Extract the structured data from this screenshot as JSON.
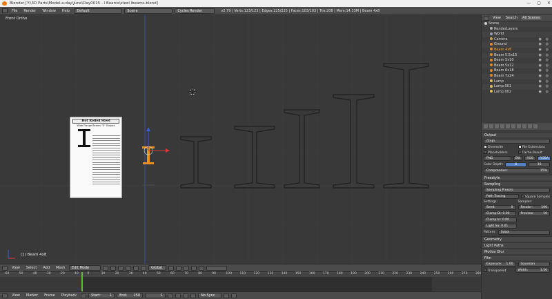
{
  "window": {
    "title": "Blender [Y:\\3D Parts\\Model-a-day\\June\\Day0015 - I Beams\\steel ibeams.blend]",
    "controls": [
      "—",
      "▢",
      "✕"
    ]
  },
  "menubar": {
    "items": [
      "File",
      "Render",
      "Window",
      "Help"
    ],
    "layout": "Default",
    "scene": "Scene",
    "engine": "Cycles Render",
    "stats": "v2.79 | Verts:123/123 | Edges:225/225 | Faces:103/103 | Tris:208 | Mem:14.33M | Beam 4x8"
  },
  "viewport": {
    "view_label": "Front Ortho",
    "object_label": "(1) Beam 4x8",
    "reference": {
      "title": "Hot Rolled Steel",
      "subtitle": "Wide Flange Beams \"S\" Shapes"
    }
  },
  "view_header": {
    "items": [
      "View",
      "Select",
      "Add",
      "Mesh"
    ],
    "mode": "Edit Mode",
    "orientation": "Global"
  },
  "timeline": {
    "ticks": [
      "-60",
      "-50",
      "-40",
      "-30",
      "-20",
      "-10",
      "0",
      "10",
      "20",
      "30",
      "40",
      "50",
      "60",
      "70",
      "80",
      "90",
      "100",
      "110",
      "120",
      "130",
      "140",
      "150",
      "160",
      "170",
      "180",
      "190",
      "200",
      "210",
      "220",
      "230",
      "240",
      "250",
      "260",
      "270",
      "280"
    ],
    "current_frame": "1",
    "menu": [
      "View",
      "Marker",
      "Frame",
      "Playback"
    ],
    "start_label": "Start:",
    "start": "1",
    "end_label": "End:",
    "end": "250",
    "frame": "1",
    "sync": "No Sync"
  },
  "outliner": {
    "tabs": [
      "View",
      "Search",
      "All Scenes"
    ],
    "items": [
      {
        "name": "Scene",
        "color": "#d0d0d0",
        "selected": false
      },
      {
        "name": "RenderLayers",
        "color": "#b0b0b0",
        "selected": false
      },
      {
        "name": "World",
        "color": "#9aa0b5",
        "selected": false
      },
      {
        "name": "Camera",
        "color": "#c8a25a",
        "selected": false
      },
      {
        "name": "Ground",
        "color": "#e08a2c",
        "selected": false
      },
      {
        "name": "Beam 4x8",
        "color": "#e08a2c",
        "selected": true
      },
      {
        "name": "Beam 5.5x15",
        "color": "#e08a2c",
        "selected": false
      },
      {
        "name": "Beam 5x10",
        "color": "#e08a2c",
        "selected": false
      },
      {
        "name": "Beam 5x12",
        "color": "#e08a2c",
        "selected": false
      },
      {
        "name": "Beam 6x18",
        "color": "#e08a2c",
        "selected": false
      },
      {
        "name": "Beam 7x24",
        "color": "#e08a2c",
        "selected": false
      },
      {
        "name": "Lamp",
        "color": "#e0c060",
        "selected": false
      },
      {
        "name": "Lamp.001",
        "color": "#e0c060",
        "selected": false
      },
      {
        "name": "Lamp.002",
        "color": "#e0c060",
        "selected": false
      }
    ]
  },
  "properties": {
    "output_header": "Output",
    "output_path": "/tmp\\",
    "overwrite": "Overwrite",
    "file_extensions": "File Extensions",
    "placeholders": "Placeholders",
    "cache_result": "Cache Result",
    "format": "PNG",
    "channels": [
      "BW",
      "RGB",
      "RGBA"
    ],
    "color_depth_label": "Color Depth:",
    "depths": [
      "8",
      "16"
    ],
    "compression_label": "Compression:",
    "compression": "15%",
    "freestyle": "Freestyle",
    "sampling_header": "Sampling",
    "sampling_presets": "Sampling Presets",
    "integrator": "Path Tracing",
    "square_samples": "Square Samples",
    "settings_label": "Settings:",
    "samples_label": "Samples:",
    "seed_label": "Seed:",
    "seed": "0",
    "render_label": "Render:",
    "render": "100",
    "clamp_direct": "Clamp Di: 0.00",
    "preview_label": "Preview:",
    "preview": "10",
    "clamp_indirect": "Clamp In: 0.00",
    "light_sampling": "Light Sa: 0.01",
    "pattern_label": "Pattern:",
    "pattern": "Sobol",
    "geometry": "Geometry",
    "light_paths": "Light Paths",
    "motion_blur": "Motion Blur",
    "film": "Film",
    "exposure_label": "Exposure:",
    "exposure": "1.00",
    "filter": "Gaussian",
    "transparent": "Transparent",
    "width_label": "Width:",
    "width": "1.50"
  }
}
